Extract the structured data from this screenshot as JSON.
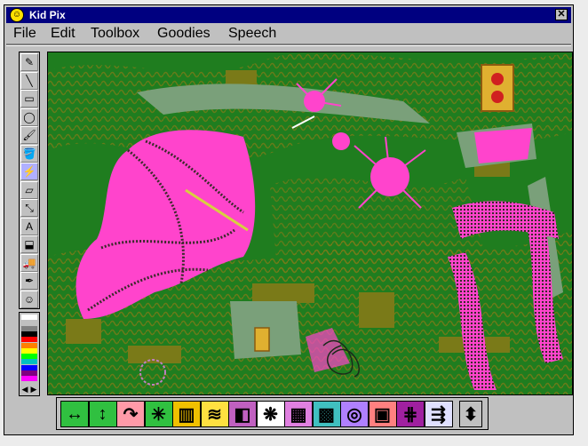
{
  "window": {
    "title": "Kid Pix",
    "close_glyph": "✕",
    "icon_glyph": "☺"
  },
  "menu": [
    {
      "label": "File"
    },
    {
      "label": "Edit"
    },
    {
      "label": "Toolbox"
    },
    {
      "label": "Goodies"
    },
    {
      "label": "Speech"
    }
  ],
  "toolbox": {
    "tools": [
      {
        "name": "wacky-pencil-icon",
        "glyph": "✎",
        "active": false
      },
      {
        "name": "line-icon",
        "glyph": "╲",
        "active": false
      },
      {
        "name": "rectangle-icon",
        "glyph": "▭",
        "active": false
      },
      {
        "name": "oval-icon",
        "glyph": "◯",
        "active": false
      },
      {
        "name": "wacky-brush-icon",
        "glyph": "🖌",
        "active": false
      },
      {
        "name": "paint-can-icon",
        "glyph": "🪣",
        "active": false
      },
      {
        "name": "electric-mixer-icon",
        "glyph": "⚡",
        "active": true
      },
      {
        "name": "eraser-icon",
        "glyph": "▱",
        "active": false
      },
      {
        "name": "moving-van-icon",
        "glyph": "⤡",
        "active": false
      },
      {
        "name": "alphabet-icon",
        "glyph": "A",
        "active": false
      },
      {
        "name": "rubber-stamp-icon",
        "glyph": "⬓",
        "active": false
      },
      {
        "name": "truck-icon",
        "glyph": "🚚",
        "active": false
      },
      {
        "name": "eyedropper-icon",
        "glyph": "✒",
        "active": false
      },
      {
        "name": "face-icon",
        "glyph": "☺",
        "active": false
      }
    ]
  },
  "palette": {
    "colors": [
      "#ffffff",
      "#c0c0c0",
      "#808080",
      "#000000",
      "#ff0000",
      "#ff8000",
      "#ffff00",
      "#00ff00",
      "#00c0c0",
      "#0000ff",
      "#800080",
      "#ff00ff"
    ],
    "prev_glyph": "◀",
    "next_glyph": "▶"
  },
  "canvas": {
    "background": "#1f7d1f",
    "olive": "#7a7a18",
    "pink": "#ff44cc",
    "sage": "#7aa07a"
  },
  "options": [
    {
      "name": "flip-horizontal-option",
      "glyph": "↔",
      "bg": "#30c040"
    },
    {
      "name": "flip-vertical-option",
      "glyph": "↕",
      "bg": "#30c040"
    },
    {
      "name": "rotate-option",
      "glyph": "↷",
      "bg": "#ff9aa8"
    },
    {
      "name": "spider-web-option",
      "glyph": "✳",
      "bg": "#30c040"
    },
    {
      "name": "stripes-option",
      "glyph": "▥",
      "bg": "#f0c000"
    },
    {
      "name": "waves-option",
      "glyph": "≋",
      "bg": "#ffe040"
    },
    {
      "name": "shapes-option",
      "glyph": "◧",
      "bg": "#c060c0"
    },
    {
      "name": "inkblot-option",
      "glyph": "❋",
      "bg": "#ffffff"
    },
    {
      "name": "mosaic-option",
      "glyph": "▦",
      "bg": "#e080e0"
    },
    {
      "name": "texture-option",
      "glyph": "▩",
      "bg": "#40c0c0"
    },
    {
      "name": "pattern-option",
      "glyph": "◎",
      "bg": "#b080ff"
    },
    {
      "name": "squares-option",
      "glyph": "▣",
      "bg": "#ff8080"
    },
    {
      "name": "zigzag-option",
      "glyph": "⋕",
      "bg": "#a020a0"
    },
    {
      "name": "dashes-option",
      "glyph": "⇶",
      "bg": "#e0e0ff"
    }
  ],
  "scroll_option": {
    "glyph": "⬍"
  }
}
